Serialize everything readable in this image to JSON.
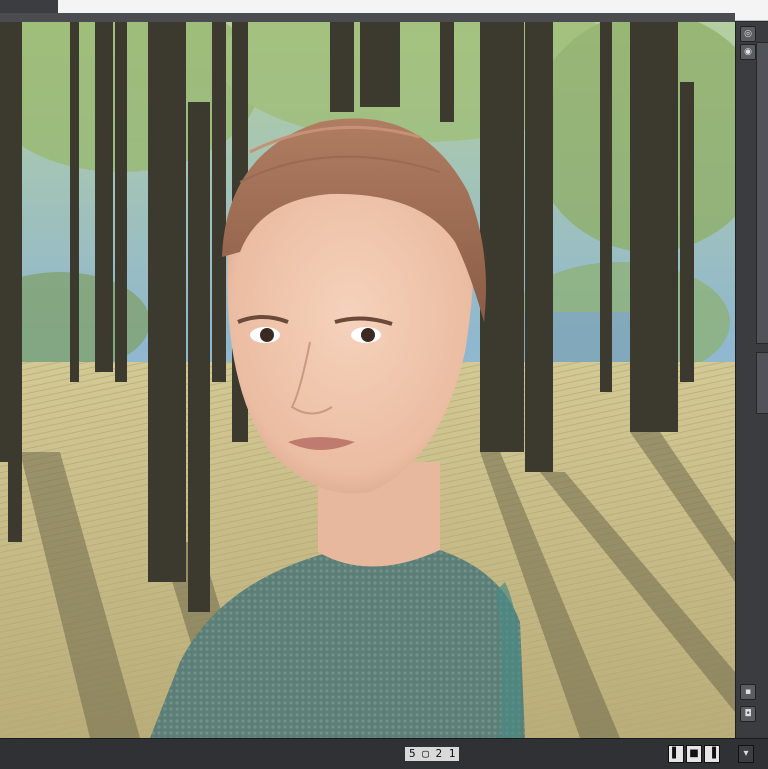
{
  "window": {
    "title": ""
  },
  "viewport": {
    "scene_description_icon": "render-viewport"
  },
  "side_panel": {
    "buttons": [
      {
        "icon": "camera-icon",
        "glyph": "◎"
      },
      {
        "icon": "eye-icon",
        "glyph": "◉"
      },
      {
        "icon": "lock-icon",
        "glyph": "▪"
      },
      {
        "icon": "settings-icon",
        "glyph": "◘"
      }
    ]
  },
  "bottom_bar": {
    "frame_readout": "5 ▢ 2 1",
    "buttons": [
      {
        "name": "play-button",
        "glyph": "▌"
      },
      {
        "name": "stop-button",
        "glyph": "■"
      },
      {
        "name": "step-button",
        "glyph": "▐"
      },
      {
        "name": "menu-button",
        "glyph": "▾"
      }
    ]
  },
  "colors": {
    "panel": "#3a3c40",
    "sky": "#9fc0d6",
    "ground": "#c9c08e",
    "trunk": "#3d3b30",
    "skin": "#f1c8b0",
    "hair": "#a9745a",
    "sweater": "#5a7d76"
  }
}
